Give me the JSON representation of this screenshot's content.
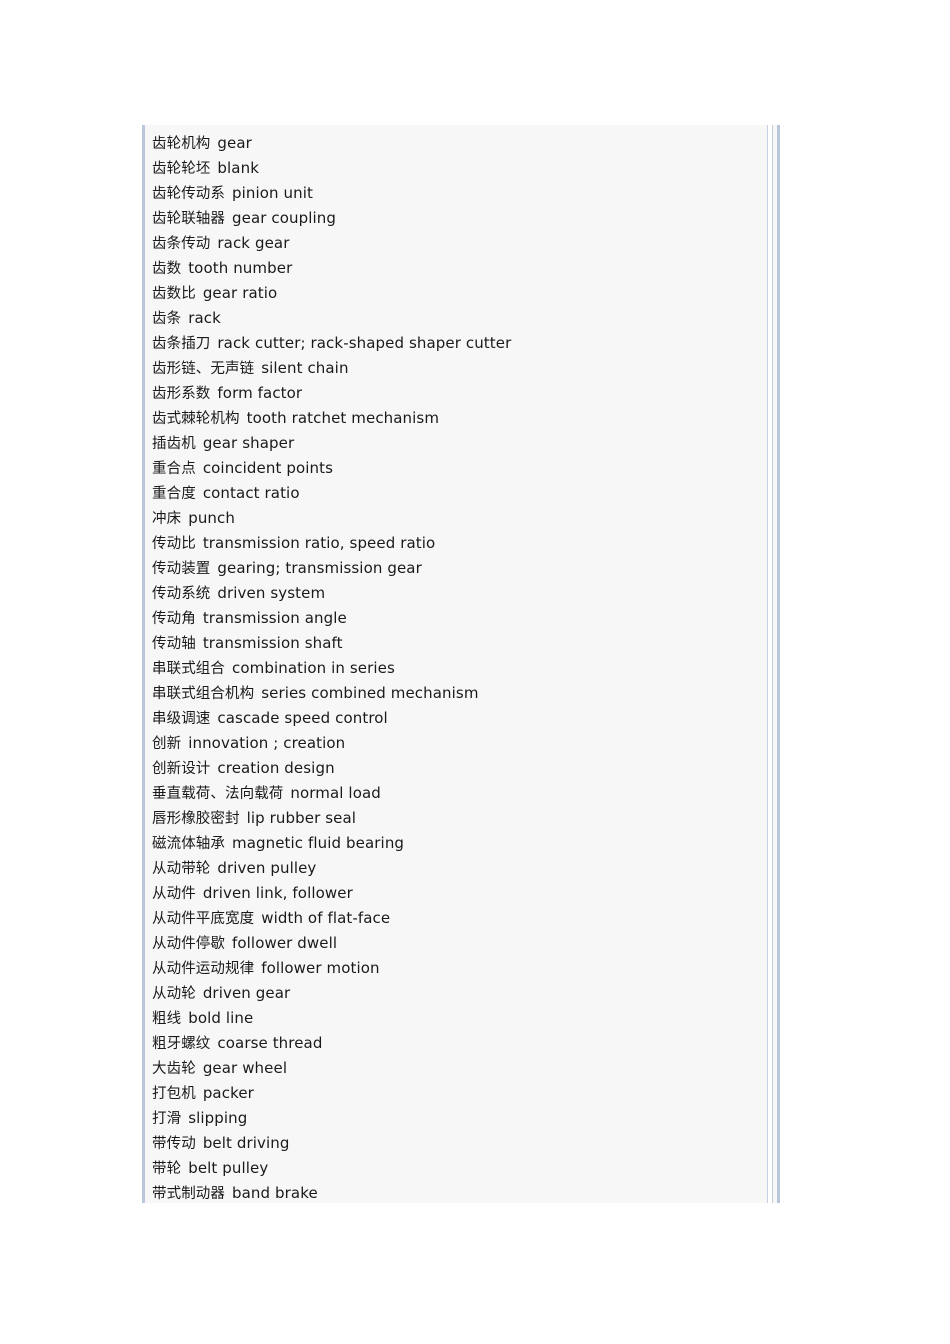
{
  "document": {
    "panel_background": "#f7f7f7",
    "page_background": "#ffffff",
    "border_color": "#b9c7dc",
    "scrollbar_color": "#b9c7dc",
    "entries": [
      {
        "term": "齿轮机构",
        "translation": "gear"
      },
      {
        "term": "齿轮轮坯",
        "translation": "blank"
      },
      {
        "term": "齿轮传动系",
        "translation": "pinion unit"
      },
      {
        "term": "齿轮联轴器",
        "translation": "gear coupling"
      },
      {
        "term": "齿条传动",
        "translation": "rack gear"
      },
      {
        "term": "齿数",
        "translation": "tooth number"
      },
      {
        "term": "齿数比",
        "translation": "gear ratio"
      },
      {
        "term": "齿条",
        "translation": "rack"
      },
      {
        "term": "齿条插刀",
        "translation": "rack cutter; rack-shaped shaper cutter"
      },
      {
        "term": "齿形链、无声链",
        "translation": "silent chain"
      },
      {
        "term": "齿形系数",
        "translation": "form factor"
      },
      {
        "term": "齿式棘轮机构",
        "translation": "tooth ratchet mechanism"
      },
      {
        "term": "插齿机",
        "translation": "gear shaper"
      },
      {
        "term": "重合点",
        "translation": "coincident points"
      },
      {
        "term": "重合度",
        "translation": "contact ratio"
      },
      {
        "term": "冲床",
        "translation": "punch"
      },
      {
        "term": "传动比",
        "translation": "transmission ratio, speed ratio"
      },
      {
        "term": "传动装置",
        "translation": "gearing; transmission gear"
      },
      {
        "term": "传动系统",
        "translation": "driven system"
      },
      {
        "term": "传动角",
        "translation": "transmission angle"
      },
      {
        "term": "传动轴",
        "translation": "transmission shaft"
      },
      {
        "term": "串联式组合",
        "translation": "combination in series"
      },
      {
        "term": "串联式组合机构",
        "translation": "series combined mechanism"
      },
      {
        "term": "串级调速",
        "translation": "cascade speed control"
      },
      {
        "term": "创新",
        "translation": "innovation ; creation"
      },
      {
        "term": "创新设计",
        "translation": "creation design"
      },
      {
        "term": "垂直载荷、法向载荷",
        "translation": "normal load"
      },
      {
        "term": "唇形橡胶密封",
        "translation": "lip rubber seal"
      },
      {
        "term": "磁流体轴承",
        "translation": "magnetic fluid bearing"
      },
      {
        "term": "从动带轮",
        "translation": "driven pulley"
      },
      {
        "term": "从动件",
        "translation": "driven link, follower"
      },
      {
        "term": "从动件平底宽度",
        "translation": "width of flat-face"
      },
      {
        "term": "从动件停歇",
        "translation": "follower dwell"
      },
      {
        "term": "从动件运动规律",
        "translation": "follower motion"
      },
      {
        "term": "从动轮",
        "translation": "driven gear"
      },
      {
        "term": "粗线",
        "translation": "bold line"
      },
      {
        "term": "粗牙螺纹",
        "translation": "coarse thread"
      },
      {
        "term": "大齿轮",
        "translation": "gear wheel"
      },
      {
        "term": "打包机",
        "translation": "packer"
      },
      {
        "term": "打滑",
        "translation": "slipping"
      },
      {
        "term": "带传动",
        "translation": "belt driving"
      },
      {
        "term": "带轮",
        "translation": "belt pulley"
      },
      {
        "term": "带式制动器",
        "translation": "band brake"
      }
    ]
  }
}
